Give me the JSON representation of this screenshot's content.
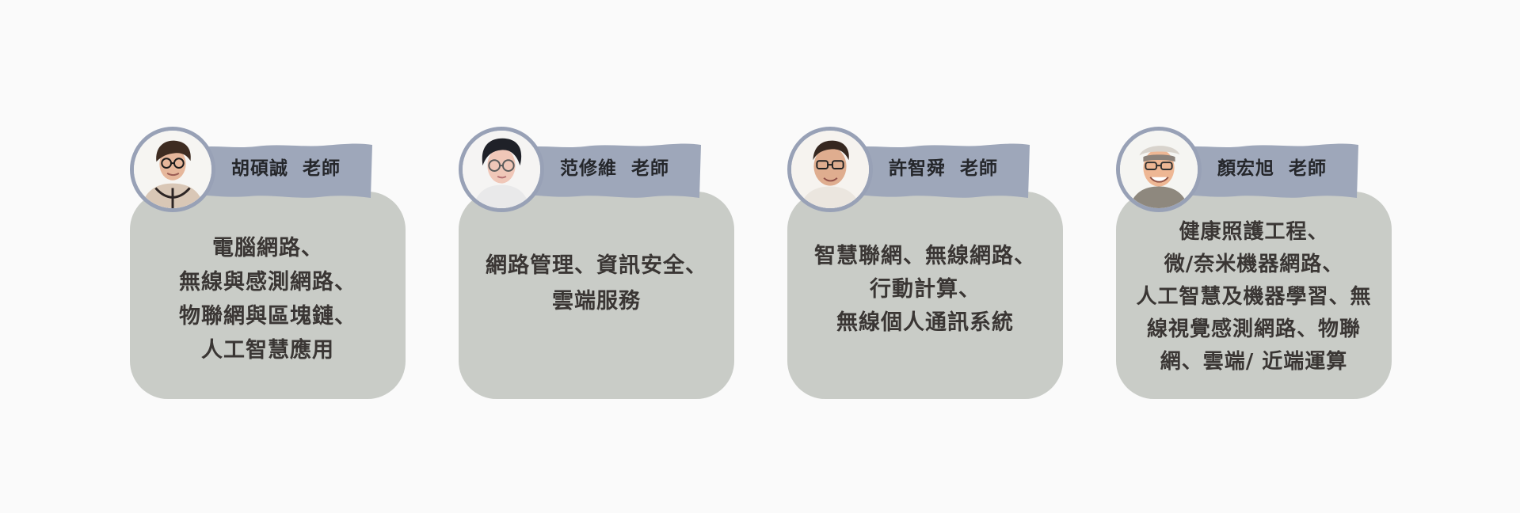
{
  "cards": [
    {
      "name": "胡碩誠  老師",
      "expertise": "電腦網路、\n無線與感測網路、\n物聯網與區塊鏈、\n人工智慧應用"
    },
    {
      "name": "范修維  老師",
      "expertise": "網路管理、資訊安全、\n雲端服務"
    },
    {
      "name": "許智舜  老師",
      "expertise": "智慧聯網、無線網路、\n行動計算、\n無線個人通訊系統"
    },
    {
      "name": "顏宏旭  老師",
      "expertise": "健康照護工程、\n微/奈米機器網路、\n人工智慧及機器學習、無\n線視覺感測網路、物聯\n網、雲端/ 近端運算"
    }
  ],
  "colors": {
    "background": "#fafafa",
    "card": "#c9ccc7",
    "banner": "#9ea7ba",
    "avatar_border": "#98a1b6",
    "text": "#3a3634"
  }
}
